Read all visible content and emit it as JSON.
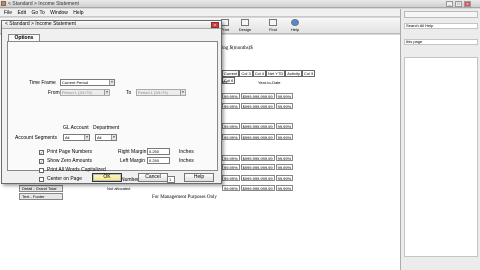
{
  "app": {
    "title": "< Standard > Income Statement"
  },
  "menu": {
    "items": [
      "File",
      "Edit",
      "Go To",
      "Window",
      "Help"
    ]
  },
  "toolbar": {
    "buttons": [
      "Print",
      "Design",
      "Find",
      "Help"
    ]
  },
  "right_pane": {
    "search_label": "Search All Help",
    "link_text": "this page"
  },
  "report": {
    "title_fragment": "ing $(months)$",
    "col_headers": [
      "Current",
      "Col 3",
      "Col 4",
      "Net YTD",
      "Activity",
      "Col 5",
      "Col 6"
    ],
    "sub_header_left": "nts",
    "sub_header_mid": "Year-to-Date",
    "row_pct": "99.99%",
    "row_amount": "$999,999,999.99",
    "footer_note": "For Management Purposes Only",
    "sample_text": "Not allocated",
    "labels": [
      "Detail - Grand Total",
      "Text - Footer"
    ]
  },
  "dialog": {
    "title": "< Standard > Income Statement",
    "tab": "Options",
    "time_frame_label": "Time Frame",
    "time_frame_value": "Current Period",
    "from_label": "From",
    "from_value": "Period 1 (3/1/79)",
    "to_label": "To",
    "to_value": "Period 1 (3/1/79)",
    "gl_account_label": "GL Account",
    "department_label": "Department",
    "account_segments_label": "Account Segments",
    "seg_gl_value": "All",
    "seg_dept_value": "All",
    "print_page_numbers": "Print Page Numbers",
    "show_zero_amounts": "Show Zero Amounts",
    "print_all_words_capitalized": "Print All Words Capitalized",
    "center_on_page": "Center on Page",
    "right_margin_label": "Right Margin",
    "right_margin_value": "0.250",
    "left_margin_label": "Left Margin",
    "left_margin_value": "0.250",
    "unit": "Inches",
    "copies_label": "Number Of Copies",
    "copies_value": "1",
    "ok": "OK",
    "cancel": "Cancel",
    "help": "Help"
  },
  "colors": {
    "ok_button": "#f4e58a",
    "close_button": "#c94141"
  }
}
